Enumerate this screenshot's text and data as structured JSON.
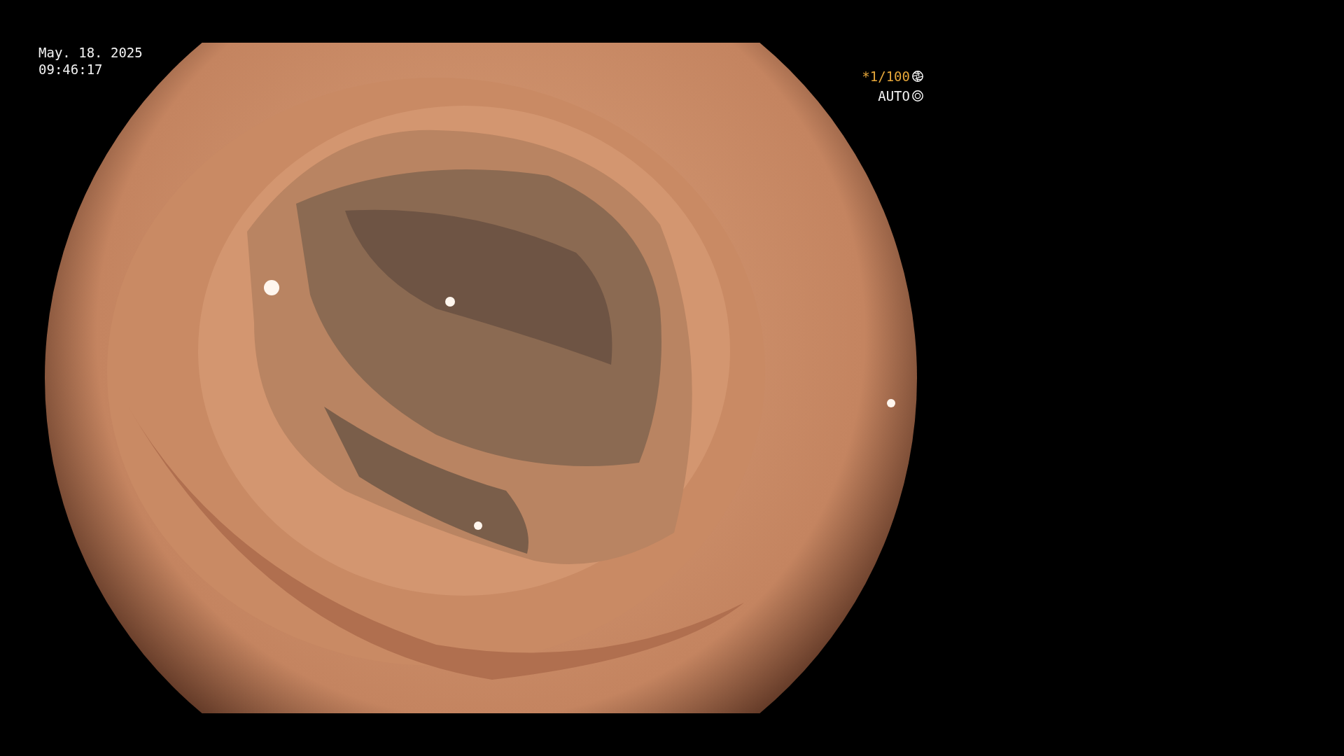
{
  "overlay_left": {
    "date": "May. 18. 2025",
    "time": "09:46:17"
  },
  "overlay_right": {
    "shutter": "*1/100",
    "iris": "AUTO"
  }
}
